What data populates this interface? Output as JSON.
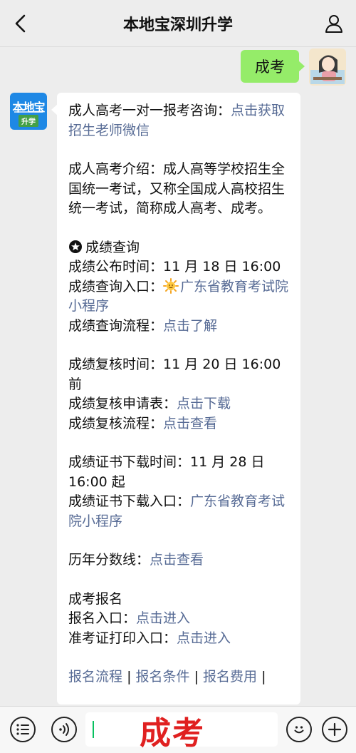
{
  "header": {
    "title": "本地宝深圳升学"
  },
  "user_message": {
    "text": "成考"
  },
  "bot": {
    "avatar_logo": "本地宝",
    "avatar_tag": "升学"
  },
  "message": {
    "consult_label": "成人高考一对一报考咨询：",
    "consult_link": "点击获取招生老师微信",
    "intro": "成人高考介绍：成人高等学校招生全国统一考试，又称全国成人高校招生统一考试，简称成人高考、成考。",
    "score_section": {
      "heading": "成绩查询",
      "publish_label": "成绩公布时间：",
      "publish_value": "11 月 18 日 16:00",
      "entry_label": "成绩查询入口：",
      "entry_link": "广东省教育考试院小程序",
      "process_label": "成绩查询流程：",
      "process_link": "点击了解"
    },
    "review_section": {
      "time_label": "成绩复核时间：",
      "time_value": "11 月 20 日 16:00 前",
      "form_label": "成绩复核申请表：",
      "form_link": "点击下载",
      "process_label": "成绩复核流程：",
      "process_link": "点击查看"
    },
    "cert_section": {
      "time_label": "成绩证书下载时间：",
      "time_value": "11 月 28 日 16:00 起",
      "entry_label": "成绩证书下载入口：",
      "entry_link": "广东省教育考试院小程序"
    },
    "history": {
      "label": "历年分数线：",
      "link": "点击查看"
    },
    "registration": {
      "heading": "成考报名",
      "entry_label": "报名入口：",
      "entry_link": "点击进入",
      "admit_label": "准考证打印入口：",
      "admit_link": "点击进入"
    },
    "bottom_links": [
      "报名流程",
      "报名条件",
      "报名费用"
    ],
    "separator": "|"
  },
  "input_bar": {
    "typed_text": "成考"
  },
  "colors": {
    "link": "#576b95",
    "user_bubble": "#95ec69",
    "overlay_text": "#e02020"
  }
}
